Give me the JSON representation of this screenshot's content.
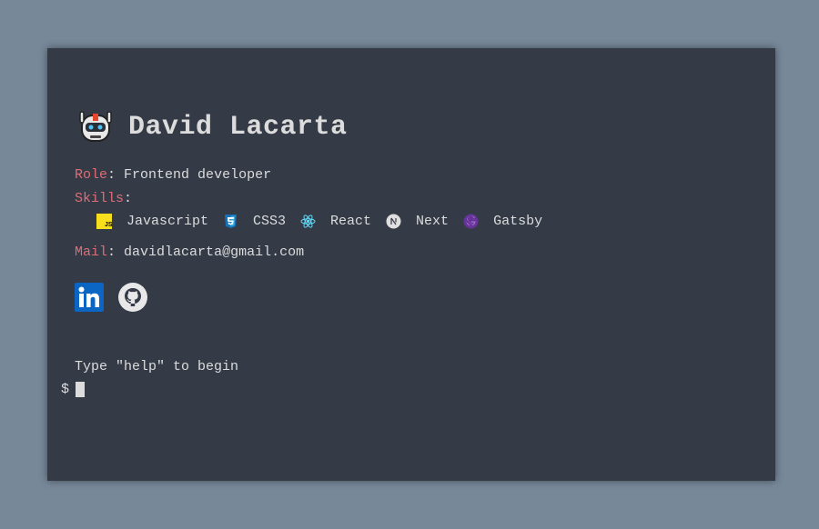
{
  "profile": {
    "name": "David Lacarta",
    "avatar_icon": "robot-icon"
  },
  "role": {
    "key": "Role",
    "colon": ":",
    "value": "Frontend developer"
  },
  "skills": {
    "key": "Skills",
    "colon": ":",
    "items": [
      {
        "label": "Javascript",
        "icon": "javascript-icon",
        "color": "#f7df1e"
      },
      {
        "label": "CSS3",
        "icon": "css3-icon",
        "color": "#1572b6"
      },
      {
        "label": "React",
        "icon": "react-icon",
        "color": "#61dafb"
      },
      {
        "label": "Next",
        "icon": "nextjs-icon",
        "color": "#e0e0e0"
      },
      {
        "label": "Gatsby",
        "icon": "gatsby-icon",
        "color": "#663399"
      }
    ]
  },
  "mail": {
    "key": "Mail",
    "colon": ":",
    "value": "davidlacarta@gmail.com"
  },
  "socials": [
    {
      "icon": "linkedin-icon",
      "color": "#0a66c2"
    },
    {
      "icon": "github-icon",
      "color": "#e8e8e8"
    }
  ],
  "terminal": {
    "hint": "Type \"help\" to begin",
    "prompt_symbol": "$"
  },
  "colors": {
    "background": "#778899",
    "terminal_bg": "#343a46",
    "key": "#e06c75",
    "text": "#dcdcdc"
  }
}
